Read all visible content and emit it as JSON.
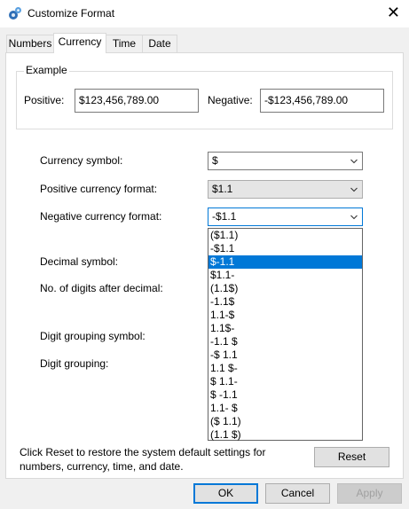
{
  "window": {
    "title": "Customize Format",
    "close_symbol": "✕"
  },
  "tabs": [
    {
      "label": "Numbers"
    },
    {
      "label": "Currency",
      "active": true
    },
    {
      "label": "Time"
    },
    {
      "label": "Date"
    }
  ],
  "example": {
    "legend": "Example",
    "positive_label": "Positive:",
    "positive_value": "$123,456,789.00",
    "negative_label": "Negative:",
    "negative_value": "-$123,456,789.00"
  },
  "settings": {
    "currency_symbol_label": "Currency symbol:",
    "currency_symbol_value": "$",
    "positive_format_label": "Positive currency format:",
    "positive_format_value": "$1.1",
    "negative_format_label": "Negative currency format:",
    "negative_format_value": "-$1.1",
    "decimal_symbol_label": "Decimal symbol:",
    "digits_after_decimal_label": "No. of digits after decimal:",
    "digit_grouping_symbol_label": "Digit grouping symbol:",
    "digit_grouping_label": "Digit grouping:"
  },
  "negative_format_options": [
    "($1.1)",
    "-$1.1",
    "$-1.1",
    "$1.1-",
    "(1.1$)",
    "-1.1$",
    "1.1-$",
    "1.1$-",
    "-1.1 $",
    "-$ 1.1",
    "1.1 $-",
    "$ 1.1-",
    "$ -1.1",
    "1.1- $",
    "($ 1.1)",
    "(1.1 $)"
  ],
  "negative_format_selected_index": 2,
  "reset_note": "Click Reset to restore the system default settings for numbers, currency, time, and date.",
  "buttons": {
    "reset": "Reset",
    "ok": "OK",
    "cancel": "Cancel",
    "apply": "Apply"
  },
  "colors": {
    "accent": "#0078d7",
    "selection_bg": "#0078d7"
  }
}
